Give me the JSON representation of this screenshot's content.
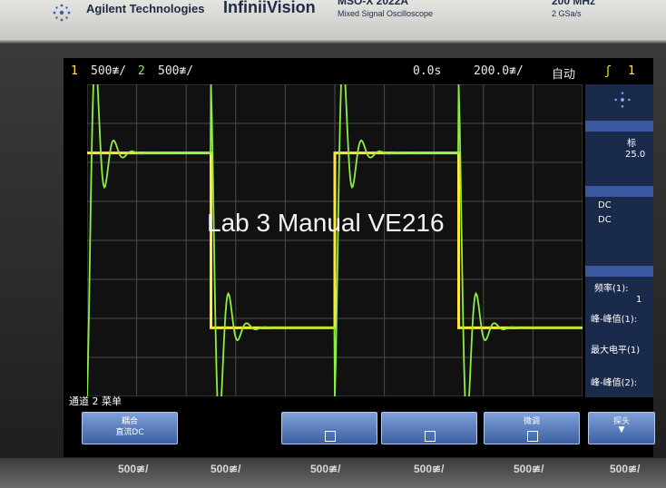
{
  "brand": {
    "company": "Agilent Technologies",
    "product": "InfiniiVision",
    "series": "MSO-X 2022A",
    "subtitle": "Mixed Signal Oscilloscope",
    "bandwidth": "200 MHz",
    "sample_rate": "2 GSa/s"
  },
  "status": {
    "ch1_num": "1",
    "ch1_scale": "500≇/",
    "ch2_num": "2",
    "ch2_scale": "500≇/",
    "time_offset": "0.0s",
    "time_scale": "200.0≇/",
    "trigger_mode": "自动",
    "trigger_icon": "ʃ",
    "trigger_src": "1"
  },
  "waveform": {
    "ch1_color": "#ffe838",
    "ch2_color": "#8cf040",
    "high_level": "",
    "ch1_points": [
      [
        0,
        0.78
      ],
      [
        0.25,
        0.78
      ],
      [
        0.25,
        0.22
      ],
      [
        0.5,
        0.22
      ],
      [
        0.5,
        0.78
      ],
      [
        0.75,
        0.78
      ],
      [
        0.75,
        0.22
      ],
      [
        1,
        0.22
      ]
    ]
  },
  "side": {
    "section1": "标",
    "value1": "25.0",
    "dc1": "DC",
    "dc2": "DC",
    "section2": "频率(1):",
    "val2": "1",
    "section3": "峰-峰值(1):",
    "section4": "最大电平(1)",
    "section5": "峰-峰值(2):"
  },
  "softkeys": {
    "menu_title": "通道 2 菜单",
    "k1_line1": "耦合",
    "k1_line2": "直流DC",
    "k4_line1": "微调",
    "k5_line1": "探头"
  },
  "overlay": {
    "text": "Lab 3 Manual VE216"
  },
  "knobs": {
    "k1": "500≇/",
    "k2": "500≇/",
    "k3": "500≇/",
    "k4": "500≇/",
    "k5": "500≇/",
    "k6": "500≇/"
  }
}
